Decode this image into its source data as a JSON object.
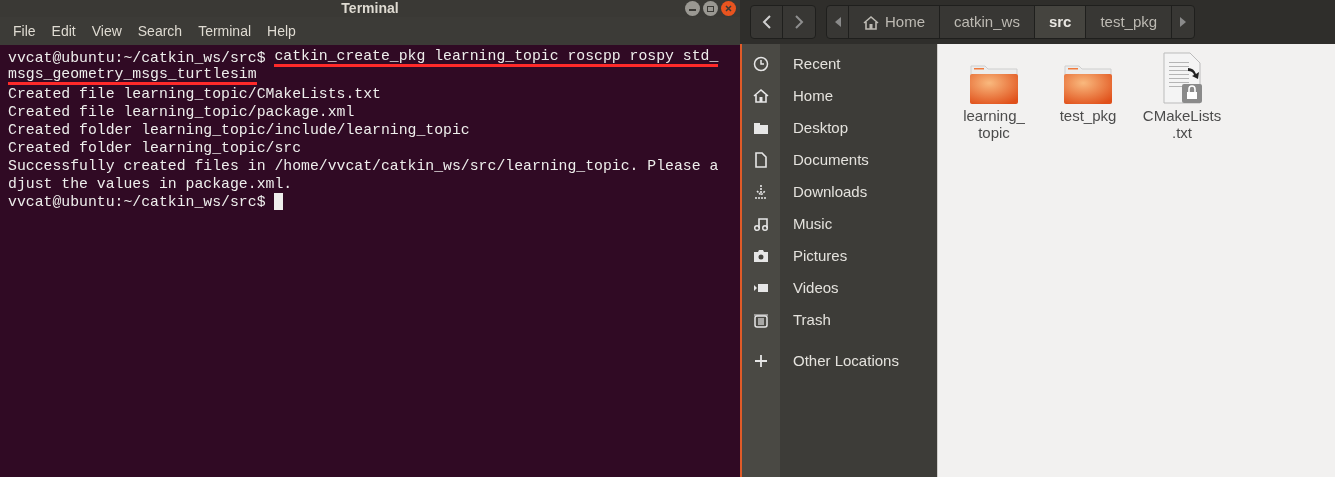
{
  "terminal": {
    "title": "Terminal",
    "menu": [
      "File",
      "Edit",
      "View",
      "Search",
      "Terminal",
      "Help"
    ],
    "rows": [
      {
        "kind": "text",
        "segments": [
          {
            "text": "vvcat@ubuntu:~/catkin_ws/src$ ",
            "underlined": false
          },
          {
            "text": "catkin_create_pkg learning_topic roscpp rospy std_",
            "underlined": true
          }
        ]
      },
      {
        "kind": "text",
        "segments": [
          {
            "text": "msgs_geometry_msgs_turtlesim",
            "underlined": true
          }
        ]
      },
      {
        "kind": "text",
        "segments": [
          {
            "text": "Created file learning_topic/CMakeLists.txt",
            "underlined": false
          }
        ]
      },
      {
        "kind": "text",
        "segments": [
          {
            "text": "Created file learning_topic/package.xml",
            "underlined": false
          }
        ]
      },
      {
        "kind": "text",
        "segments": [
          {
            "text": "Created folder learning_topic/include/learning_topic",
            "underlined": false
          }
        ]
      },
      {
        "kind": "text",
        "segments": [
          {
            "text": "Created folder learning_topic/src",
            "underlined": false
          }
        ]
      },
      {
        "kind": "text",
        "segments": [
          {
            "text": "Successfully created files in /home/vvcat/catkin_ws/src/learning_topic. Please a",
            "underlined": false
          }
        ]
      },
      {
        "kind": "text",
        "segments": [
          {
            "text": "djust the values in package.xml.",
            "underlined": false
          }
        ]
      },
      {
        "kind": "cursor",
        "segments": [
          {
            "text": "vvcat@ubuntu:~/catkin_ws/src$ ",
            "underlined": false
          }
        ]
      }
    ]
  },
  "files": {
    "path": [
      {
        "label": "Home",
        "kind": "home",
        "selected": false
      },
      {
        "label": "catkin_ws",
        "kind": "dir",
        "selected": false
      },
      {
        "label": "src",
        "kind": "dir",
        "selected": true
      },
      {
        "label": "test_pkg",
        "kind": "dir",
        "selected": false
      }
    ],
    "sidebar": [
      {
        "label": "Recent",
        "kind": "recent"
      },
      {
        "label": "Home",
        "kind": "home"
      },
      {
        "label": "Desktop",
        "kind": "desktop"
      },
      {
        "label": "Documents",
        "kind": "documents"
      },
      {
        "label": "Downloads",
        "kind": "downloads"
      },
      {
        "label": "Music",
        "kind": "music"
      },
      {
        "label": "Pictures",
        "kind": "pictures"
      },
      {
        "label": "Videos",
        "kind": "videos"
      },
      {
        "label": "Trash",
        "kind": "trash"
      },
      {
        "label": "Other Locations",
        "kind": "other"
      }
    ],
    "items": [
      {
        "lines": [
          "learning_",
          "topic"
        ],
        "kind": "folder"
      },
      {
        "lines": [
          "test_pkg"
        ],
        "kind": "folder"
      },
      {
        "lines": [
          "CMakeLists",
          ".txt"
        ],
        "kind": "textfile"
      }
    ]
  }
}
